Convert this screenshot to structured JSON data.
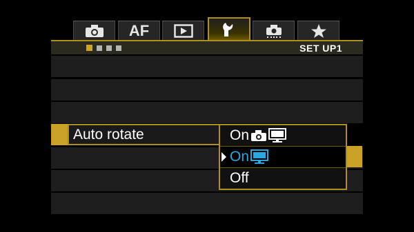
{
  "tabs": [
    {
      "icon": "camera-icon",
      "label": ""
    },
    {
      "icon": "af-icon",
      "label": "AF"
    },
    {
      "icon": "playback-icon",
      "label": ""
    },
    {
      "icon": "wrench-icon",
      "label": ""
    },
    {
      "icon": "custom-function-icon",
      "label": ""
    },
    {
      "icon": "star-icon",
      "label": ""
    }
  ],
  "active_tab": "wrench-icon",
  "page": {
    "title": "SET UP1",
    "page_count": 4,
    "current_page": 1
  },
  "menu": {
    "selected_item": "Auto rotate",
    "options": [
      {
        "label": "On",
        "icons": [
          "camera-icon",
          "monitor-icon"
        ]
      },
      {
        "label": "On",
        "icons": [
          "monitor-icon"
        ]
      },
      {
        "label": "Off",
        "icons": []
      }
    ],
    "highlighted_option": 1
  },
  "colors": {
    "accent": "#c9a227",
    "highlight_text": "#2aa6e0"
  }
}
